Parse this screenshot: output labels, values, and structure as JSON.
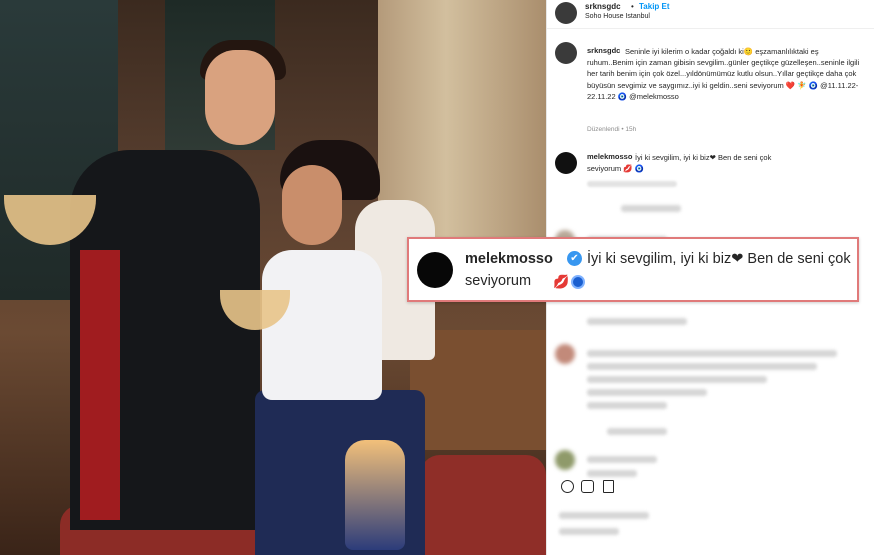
{
  "post": {
    "username": "srknsgdc",
    "dot": "•",
    "follow_label": "Takip Et",
    "location": "Soho House Istanbul"
  },
  "caption": {
    "username": "srknsgdc",
    "text": "Seninle iyi kilerim o kadar çoğaldı ki🙂 eşzamanlılıktaki eş ruhum..Benim için zaman gibisin sevgilim..günler geçtikçe güzelleşen..seninle ilgili her tarih benim için çok özel...yıldönümümüz kutlu olsun..Yıllar geçtikçe daha çok büyüsün sevgimiz ve saygımız..iyi ki geldin..seni seviyorum ❤️ 🧚 🧿 @11.11.22-22.11.22 🧿 @melekmosso",
    "edited": "Düzenlendi • 15h"
  },
  "comment": {
    "username": "melekmosso",
    "text": "İyi ki sevgilim, iyi ki biz❤ Ben de seni çok seviyorum 💋 🧿"
  },
  "highlight": {
    "username": "melekmosso",
    "verified_mark": "✔",
    "line1": "İyi ki sevgilim, iyi ki biz❤ Ben de seni çok",
    "line2": "seviyorum",
    "lips": "💋"
  },
  "icons": [
    "heart-icon",
    "comment-icon",
    "share-icon"
  ],
  "colors": {
    "link": "#0095f6",
    "highlight_border": "#e07a7a",
    "verified": "#3897f0"
  }
}
